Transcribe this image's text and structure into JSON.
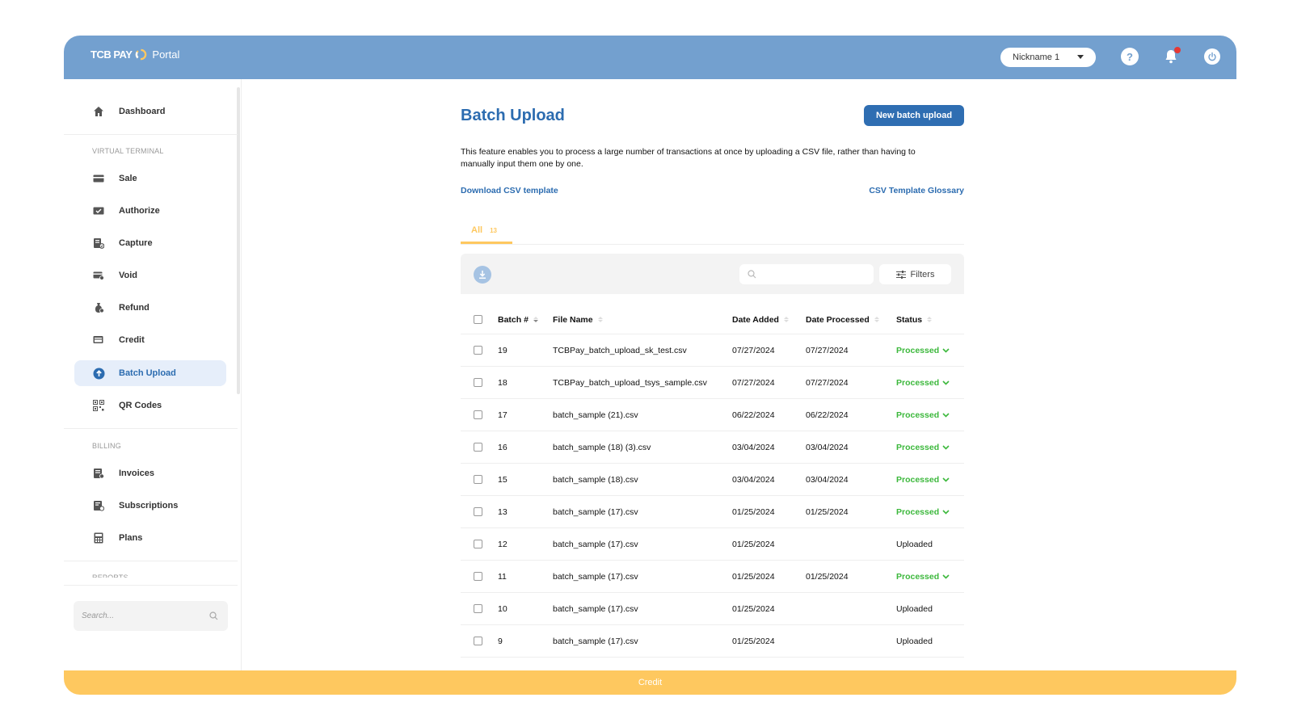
{
  "header": {
    "brand": "TCB PAY",
    "portal_label": "Portal",
    "nickname": "Nickname 1",
    "help_label": "?"
  },
  "sidebar": {
    "items": [
      {
        "label": "Dashboard",
        "icon": "home-icon"
      },
      {
        "label": "Sale",
        "icon": "card-icon"
      },
      {
        "label": "Authorize",
        "icon": "check-card-icon"
      },
      {
        "label": "Capture",
        "icon": "capture-icon"
      },
      {
        "label": "Void",
        "icon": "void-card-icon"
      },
      {
        "label": "Refund",
        "icon": "refund-icon"
      },
      {
        "label": "Credit",
        "icon": "credit-icon"
      },
      {
        "label": "Batch Upload",
        "icon": "upload-icon"
      },
      {
        "label": "QR Codes",
        "icon": "qr-icon"
      },
      {
        "label": "Invoices",
        "icon": "invoice-icon"
      },
      {
        "label": "Subscriptions",
        "icon": "subscription-icon"
      },
      {
        "label": "Plans",
        "icon": "calculator-icon"
      }
    ],
    "sections": {
      "virtual_terminal": "VIRTUAL TERMINAL",
      "billing": "BILLING",
      "reports": "REPORTS"
    },
    "search_placeholder": "Search..."
  },
  "main": {
    "title": "Batch Upload",
    "new_button": "New batch upload",
    "description": "This feature enables you to process a large number of transactions at once by uploading a CSV file, rather than having to manually input them one by one.",
    "download_link": "Download CSV template",
    "glossary_link": "CSV Template Glossary",
    "tab_all_label": "All",
    "tab_all_count": "13",
    "filters_label": "Filters"
  },
  "table": {
    "headers": {
      "batch": "Batch #",
      "file": "File Name",
      "added": "Date Added",
      "processed": "Date Processed",
      "status": "Status"
    },
    "rows": [
      {
        "batch": "19",
        "file": "TCBPay_batch_upload_sk_test.csv",
        "added": "07/27/2024",
        "processed": "07/27/2024",
        "status": "Processed"
      },
      {
        "batch": "18",
        "file": "TCBPay_batch_upload_tsys_sample.csv",
        "added": "07/27/2024",
        "processed": "07/27/2024",
        "status": "Processed"
      },
      {
        "batch": "17",
        "file": "batch_sample (21).csv",
        "added": "06/22/2024",
        "processed": "06/22/2024",
        "status": "Processed"
      },
      {
        "batch": "16",
        "file": "batch_sample (18) (3).csv",
        "added": "03/04/2024",
        "processed": "03/04/2024",
        "status": "Processed"
      },
      {
        "batch": "15",
        "file": "batch_sample (18).csv",
        "added": "03/04/2024",
        "processed": "03/04/2024",
        "status": "Processed"
      },
      {
        "batch": "13",
        "file": "batch_sample (17).csv",
        "added": "01/25/2024",
        "processed": "01/25/2024",
        "status": "Processed"
      },
      {
        "batch": "12",
        "file": "batch_sample (17).csv",
        "added": "01/25/2024",
        "processed": "",
        "status": "Uploaded"
      },
      {
        "batch": "11",
        "file": "batch_sample (17).csv",
        "added": "01/25/2024",
        "processed": "01/25/2024",
        "status": "Processed"
      },
      {
        "batch": "10",
        "file": "batch_sample (17).csv",
        "added": "01/25/2024",
        "processed": "",
        "status": "Uploaded"
      },
      {
        "batch": "9",
        "file": "batch_sample (17).csv",
        "added": "01/25/2024",
        "processed": "",
        "status": "Uploaded"
      }
    ]
  },
  "footer": {
    "label": "Credit"
  },
  "colors": {
    "topbar": "#73a0cf",
    "accent": "#2f6eb2",
    "footer": "#fec85f",
    "processed": "#3cb83c"
  }
}
